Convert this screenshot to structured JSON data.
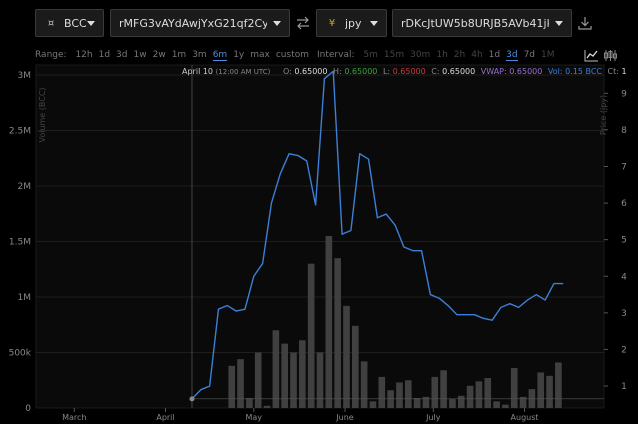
{
  "toolbar": {
    "base": {
      "symbol": "¤",
      "code": "BCC"
    },
    "base_issuer": "rMFG3vAYdAwjYxG21qf2CyZ...",
    "quote": {
      "symbol": "¥",
      "code": "jpy"
    },
    "quote_issuer": "rDKcJtUW5b8URJB5AVb41jkT..."
  },
  "range": {
    "label": "Range:",
    "options": [
      {
        "label": "12h",
        "state": "normal"
      },
      {
        "label": "1d",
        "state": "normal"
      },
      {
        "label": "3d",
        "state": "normal"
      },
      {
        "label": "1w",
        "state": "normal"
      },
      {
        "label": "2w",
        "state": "normal"
      },
      {
        "label": "1m",
        "state": "normal"
      },
      {
        "label": "3m",
        "state": "normal"
      },
      {
        "label": "6m",
        "state": "active"
      },
      {
        "label": "1y",
        "state": "normal"
      },
      {
        "label": "max",
        "state": "normal"
      },
      {
        "label": "custom",
        "state": "normal"
      }
    ]
  },
  "interval": {
    "label": "Interval:",
    "options": [
      {
        "label": "5m",
        "state": "disabled"
      },
      {
        "label": "15m",
        "state": "disabled"
      },
      {
        "label": "30m",
        "state": "disabled"
      },
      {
        "label": "1h",
        "state": "disabled"
      },
      {
        "label": "2h",
        "state": "disabled"
      },
      {
        "label": "4h",
        "state": "disabled"
      },
      {
        "label": "1d",
        "state": "normal"
      },
      {
        "label": "3d",
        "state": "active"
      },
      {
        "label": "7d",
        "state": "normal"
      },
      {
        "label": "1M",
        "state": "disabled"
      }
    ]
  },
  "info": {
    "date": "April 10",
    "time": "(12:00 AM UTC)",
    "o_label": "O:",
    "o": "0.65000",
    "h_label": "H:",
    "h": "0.65000",
    "l_label": "L:",
    "l": "0.65000",
    "c_label": "C:",
    "c": "0.65000",
    "vwap_label": "VWAP:",
    "vwap": "0.65000",
    "vol_label": "Vol:",
    "vol": "0.15 BCC",
    "ct_label": "Ct:",
    "ct": "1"
  },
  "colors": {
    "line": "#3d7fd6",
    "volume_bar": "#404040",
    "grid": "#1e1e1e",
    "accent": "#4a90e2",
    "high": "#3aa43a",
    "low": "#c43a3a",
    "vwap": "#9a6fd6"
  },
  "icons": [
    "swap-icon",
    "download-icon",
    "line-chart-icon",
    "candlestick-icon"
  ],
  "chart_data": {
    "type": "line",
    "x_ticks": [
      "March",
      "April",
      "May",
      "June",
      "July",
      "August"
    ],
    "x_tick_dates": [
      "2017-03-01",
      "2017-04-01",
      "2017-05-01",
      "2017-06-01",
      "2017-07-01",
      "2017-08-01"
    ],
    "x_range": [
      "2017-02-16",
      "2017-08-28"
    ],
    "volume": {
      "axis_label": "Volume (BCC)",
      "ticks": [
        "0",
        "500k",
        "1M",
        "1.5M",
        "2M",
        "2.5M",
        "3M"
      ],
      "tick_values": [
        0,
        500000,
        1000000,
        1500000,
        2000000,
        2500000,
        3000000
      ],
      "ylim": [
        0,
        3000000
      ]
    },
    "price": {
      "axis_label": "Price (jpy)",
      "ticks": [
        "1",
        "2",
        "3",
        "4",
        "5",
        "6",
        "7",
        "8",
        "9"
      ],
      "tick_values": [
        1,
        2,
        3,
        4,
        5,
        6,
        7,
        8,
        9
      ],
      "ylim": [
        0.4,
        9.5
      ]
    },
    "series": [
      {
        "kind": "volume",
        "x": [
          "2017-04-10",
          "2017-04-13",
          "2017-04-16",
          "2017-04-19",
          "2017-04-22",
          "2017-04-25",
          "2017-04-28",
          "2017-05-01",
          "2017-05-04",
          "2017-05-07",
          "2017-05-10",
          "2017-05-13",
          "2017-05-16",
          "2017-05-19",
          "2017-05-22",
          "2017-05-25",
          "2017-05-28",
          "2017-05-31",
          "2017-06-03",
          "2017-06-06",
          "2017-06-09",
          "2017-06-12",
          "2017-06-15",
          "2017-06-18",
          "2017-06-21",
          "2017-06-24",
          "2017-06-27",
          "2017-06-30",
          "2017-07-03",
          "2017-07-06",
          "2017-07-09",
          "2017-07-12",
          "2017-07-15",
          "2017-07-18",
          "2017-07-21",
          "2017-07-24",
          "2017-07-27",
          "2017-07-30",
          "2017-08-02",
          "2017-08-05",
          "2017-08-08",
          "2017-08-11",
          "2017-08-14",
          "2017-08-17",
          "2017-08-20",
          "2017-08-23"
        ],
        "values": [
          0,
          0,
          0,
          0,
          380000,
          440000,
          90000,
          500000,
          20000,
          700000,
          580000,
          500000,
          610000,
          1300000,
          500000,
          1550000,
          1350000,
          920000,
          740000,
          420000,
          60000,
          280000,
          160000,
          230000,
          250000,
          90000,
          100000,
          280000,
          340000,
          80000,
          110000,
          200000,
          240000,
          270000,
          60000,
          30000,
          360000,
          100000,
          170000,
          320000,
          290000,
          410000,
          0,
          0,
          0,
          0
        ]
      },
      {
        "kind": "price",
        "x": [
          "2017-04-10",
          "2017-04-13",
          "2017-04-16",
          "2017-04-19",
          "2017-04-22",
          "2017-04-25",
          "2017-04-28",
          "2017-05-01",
          "2017-05-04",
          "2017-05-07",
          "2017-05-10",
          "2017-05-13",
          "2017-05-16",
          "2017-05-19",
          "2017-05-22",
          "2017-05-25",
          "2017-05-28",
          "2017-05-31",
          "2017-06-03",
          "2017-06-06",
          "2017-06-09",
          "2017-06-12",
          "2017-06-15",
          "2017-06-18",
          "2017-06-21",
          "2017-06-24",
          "2017-06-27",
          "2017-06-30",
          "2017-07-03",
          "2017-07-06",
          "2017-07-09",
          "2017-07-12",
          "2017-07-15",
          "2017-07-18",
          "2017-07-21",
          "2017-07-24",
          "2017-07-27",
          "2017-07-30",
          "2017-08-02",
          "2017-08-05",
          "2017-08-08",
          "2017-08-11",
          "2017-08-14"
        ],
        "values": [
          0.65,
          0.9,
          1.0,
          3.1,
          3.2,
          3.05,
          3.1,
          4.0,
          4.35,
          6.0,
          6.8,
          7.35,
          7.3,
          7.15,
          5.95,
          9.4,
          9.6,
          5.15,
          5.25,
          7.35,
          7.2,
          5.6,
          5.7,
          5.4,
          4.8,
          4.7,
          4.7,
          3.5,
          3.4,
          3.2,
          2.95,
          2.95,
          2.95,
          2.85,
          2.8,
          3.15,
          3.25,
          3.15,
          3.35,
          3.5,
          3.35,
          3.8,
          3.8
        ]
      }
    ]
  }
}
